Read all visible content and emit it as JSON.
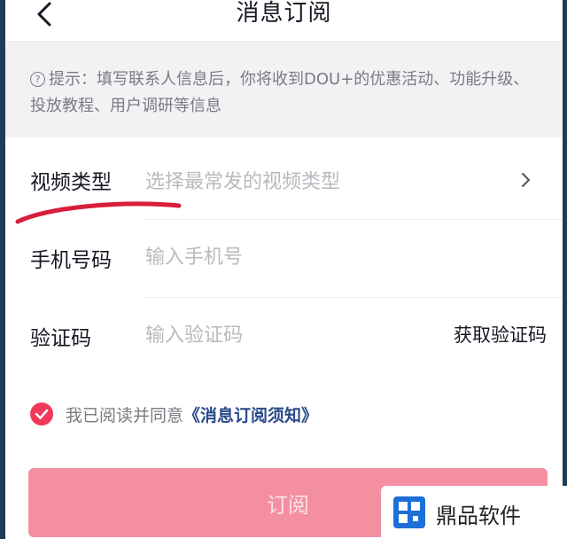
{
  "header": {
    "title": "消息订阅"
  },
  "notice": {
    "icon": "question-circle-icon",
    "text": "提示：填写联系人信息后，你将收到DOU+的优惠活动、功能升级、投放教程、用户调研等信息"
  },
  "form": {
    "video_type": {
      "label": "视频类型",
      "placeholder": "选择最常发的视频类型"
    },
    "phone": {
      "label": "手机号码",
      "placeholder": "输入手机号"
    },
    "code": {
      "label": "验证码",
      "placeholder": "输入验证码",
      "action": "获取验证码"
    }
  },
  "agreement": {
    "prefix": "我已阅读并同意",
    "link": "《消息订阅须知》",
    "checked": true
  },
  "submit": {
    "label": "订阅"
  },
  "watermark": {
    "text": "鼎品软件"
  },
  "colors": {
    "accent": "#f2395a",
    "button": "#f48fa2",
    "link": "#2b4a8b",
    "annotation": "#d81e3c"
  }
}
